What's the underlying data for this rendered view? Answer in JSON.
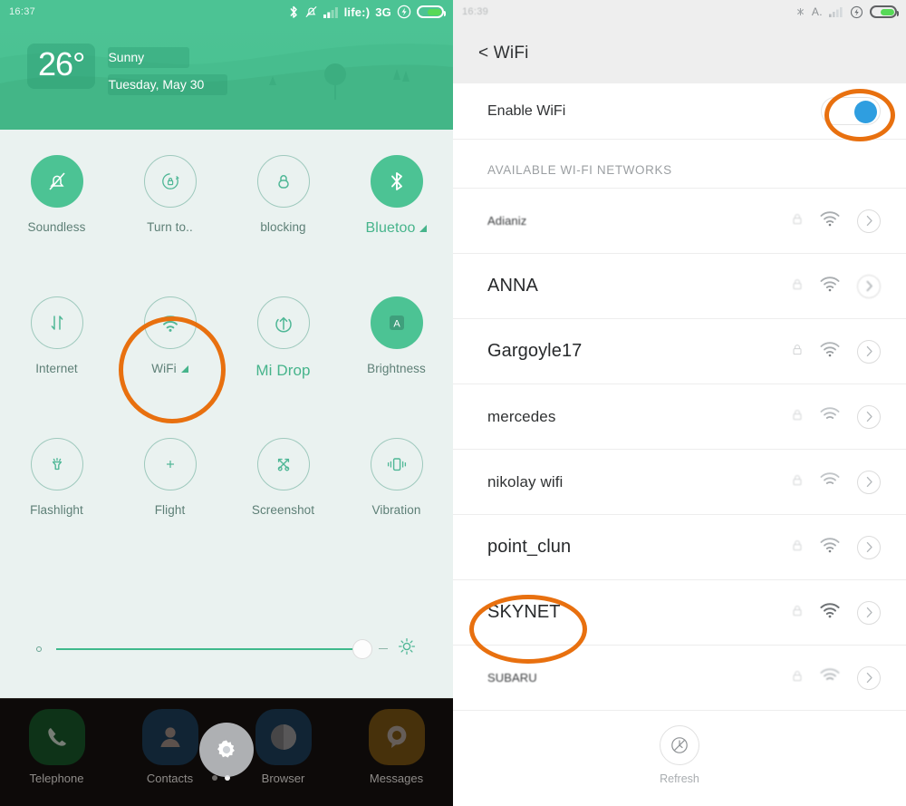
{
  "left": {
    "statusbar": {
      "time": "16:37",
      "carrier": "life:)",
      "network": "3G",
      "icons": [
        "bluetooth-icon",
        "bell-muted-icon",
        "signal-bars-icon",
        "charging-bolt-icon",
        "battery-icon"
      ]
    },
    "weather": {
      "temperature": "26°",
      "condition": "Sunny",
      "date": "Tuesday, May 30"
    },
    "toggles": [
      {
        "label": "Soundless",
        "icon": "bell-muted-icon",
        "active": true,
        "expand": false
      },
      {
        "label": "Turn to..",
        "icon": "rotate-lock-icon",
        "active": false,
        "expand": false
      },
      {
        "label": "blocking",
        "icon": "lock-icon",
        "active": false,
        "expand": false
      },
      {
        "label": "Bluetoo",
        "icon": "bluetooth-icon",
        "active": true,
        "expand": true
      },
      {
        "label": "Internet",
        "icon": "data-transfer-icon",
        "active": false,
        "expand": false
      },
      {
        "label": "WiFi",
        "icon": "wifi-icon",
        "active": false,
        "expand": true
      },
      {
        "label": "Mi Drop",
        "icon": "upload-circle-icon",
        "active": false,
        "expand": false
      },
      {
        "label": "Brightness",
        "icon": "auto-brightness-icon",
        "active": true,
        "expand": false
      },
      {
        "label": "Flashlight",
        "icon": "flashlight-icon",
        "active": false,
        "expand": false
      },
      {
        "label": "Flight",
        "icon": "plus-icon",
        "active": false,
        "expand": false
      },
      {
        "label": "Screenshot",
        "icon": "scissors-icon",
        "active": false,
        "expand": false
      },
      {
        "label": "Vibration",
        "icon": "vibration-icon",
        "active": false,
        "expand": false
      }
    ],
    "brightness": {
      "value_percent": 94,
      "left_icon": "small-brightness-icon",
      "right_icon": "sun-icon"
    },
    "dock": {
      "apps": [
        {
          "label": "Telephone",
          "icon": "phone-icon",
          "color": "#0f4d22"
        },
        {
          "label": "Contacts",
          "icon": "person-icon",
          "color": "#14354f"
        },
        {
          "label": "Browser",
          "icon": "compass-icon",
          "color": "#14354f"
        },
        {
          "label": "Messages",
          "icon": "chat-icon",
          "color": "#6b4a0d"
        }
      ],
      "page_dots": 2,
      "active_dot": 2,
      "overlay_icon": "gear-icon"
    }
  },
  "right": {
    "statusbar": {
      "time": "16:39",
      "alarm": "A.",
      "icons": [
        "bluetooth-icon",
        "signal-bars-icon",
        "charging-bolt-icon",
        "battery-icon"
      ]
    },
    "titlebar": {
      "back_icon": "chevron-left-icon",
      "title": "< WiFi"
    },
    "enable": {
      "label": "Enable WiFi",
      "toggle_on": true,
      "knob_color": "#2f9ee0"
    },
    "section_header": "AVAILABLE WI-FI NETWORKS",
    "networks": [
      {
        "ssid": "Adianiz",
        "secured": true,
        "signal": 3,
        "size": "sm",
        "blurry": true,
        "chevron": "chevron-right-icon"
      },
      {
        "ssid": "ANNA",
        "secured": true,
        "signal": 3,
        "size": "lg",
        "blurry": false,
        "chevron": "chevron-right-icon"
      },
      {
        "ssid": "Gargoyle17",
        "secured": true,
        "signal": 3,
        "size": "lg",
        "blurry": false,
        "chevron": "chevron-right-icon"
      },
      {
        "ssid": "mercedes",
        "secured": true,
        "signal": 2,
        "size": "md",
        "blurry": false,
        "chevron": "chevron-right-icon"
      },
      {
        "ssid": "nikolay wifi",
        "secured": true,
        "signal": 2,
        "size": "md",
        "blurry": false,
        "chevron": "chevron-right-icon"
      },
      {
        "ssid": "point_clun",
        "secured": true,
        "signal": 3,
        "size": "lg",
        "blurry": false,
        "chevron": "chevron-right-icon"
      },
      {
        "ssid": "SKYNET",
        "secured": true,
        "signal": 4,
        "size": "lg",
        "blurry": false,
        "chevron": "chevron-right-icon"
      },
      {
        "ssid": "SUBARU",
        "secured": true,
        "signal": 2,
        "size": "sm",
        "blurry": true,
        "chevron": "chevron-right-icon"
      }
    ],
    "refresh": {
      "label": "Refresh",
      "icon": "refresh-clock-icon"
    }
  },
  "annotations": {
    "highlight_color": "#e8700f",
    "targets": [
      "wifi-toggle",
      "enable-wifi-switch",
      "skynet-network"
    ]
  }
}
